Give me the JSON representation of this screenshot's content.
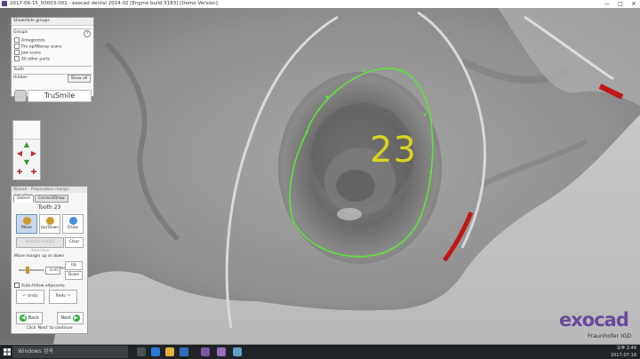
{
  "window": {
    "title": "2017-06-15_00003-001 - exocad dental 2014.02 [Engine build 5183] [Demo Version]",
    "minimize": "—",
    "maximize": "□",
    "close": "✕"
  },
  "viewport": {
    "tooth_label": "23",
    "colors": {
      "margin_line": "#5fe33a",
      "label": "#d8d41e",
      "model": "#9a9a9a"
    }
  },
  "groups_panel": {
    "header": "Show/Hide groups",
    "section_groups": "Groups",
    "items": [
      "Antagonists",
      "Pre-op/Waxup scans",
      "Jaw scans",
      "All other parts"
    ],
    "section_tooth": "Tooth",
    "section_hidden": "Hidden",
    "show_all": "Show all",
    "help": "?",
    "trusmile": "TruSmile"
  },
  "toolbar": {
    "icons": [
      "view-top-icon",
      "view-left-icon",
      "view-right-icon",
      "view-front-icon",
      "view-back-icon",
      "view-bottom-icon"
    ]
  },
  "wizard": {
    "header": "Wizard - Preparation margin detection",
    "tabs": [
      "Detect",
      "Correct/Draw"
    ],
    "tooth": "Tooth 23",
    "modes": [
      "Move",
      "Up/Down",
      "Draw"
    ],
    "action_disabled": "Restart margin detection",
    "clear": "Clear",
    "move_label": "Move margin up or down",
    "offset_value": "0.05",
    "unit": "mm",
    "up": "Up",
    "down": "Down",
    "auto_follow": "Auto-follow adjacents",
    "undo": "Undo",
    "redo": "Redo",
    "back": "Back",
    "next": "Next",
    "hint": "Click 'Next' to continue"
  },
  "brand": {
    "name": "exocad",
    "sub": "Fraunhofer",
    "sub2": "IGD",
    "color": "#6a4a9f"
  },
  "taskbar": {
    "search_text": "Windows 검색",
    "time": "오후 2:49",
    "date": "2017-07-18"
  }
}
